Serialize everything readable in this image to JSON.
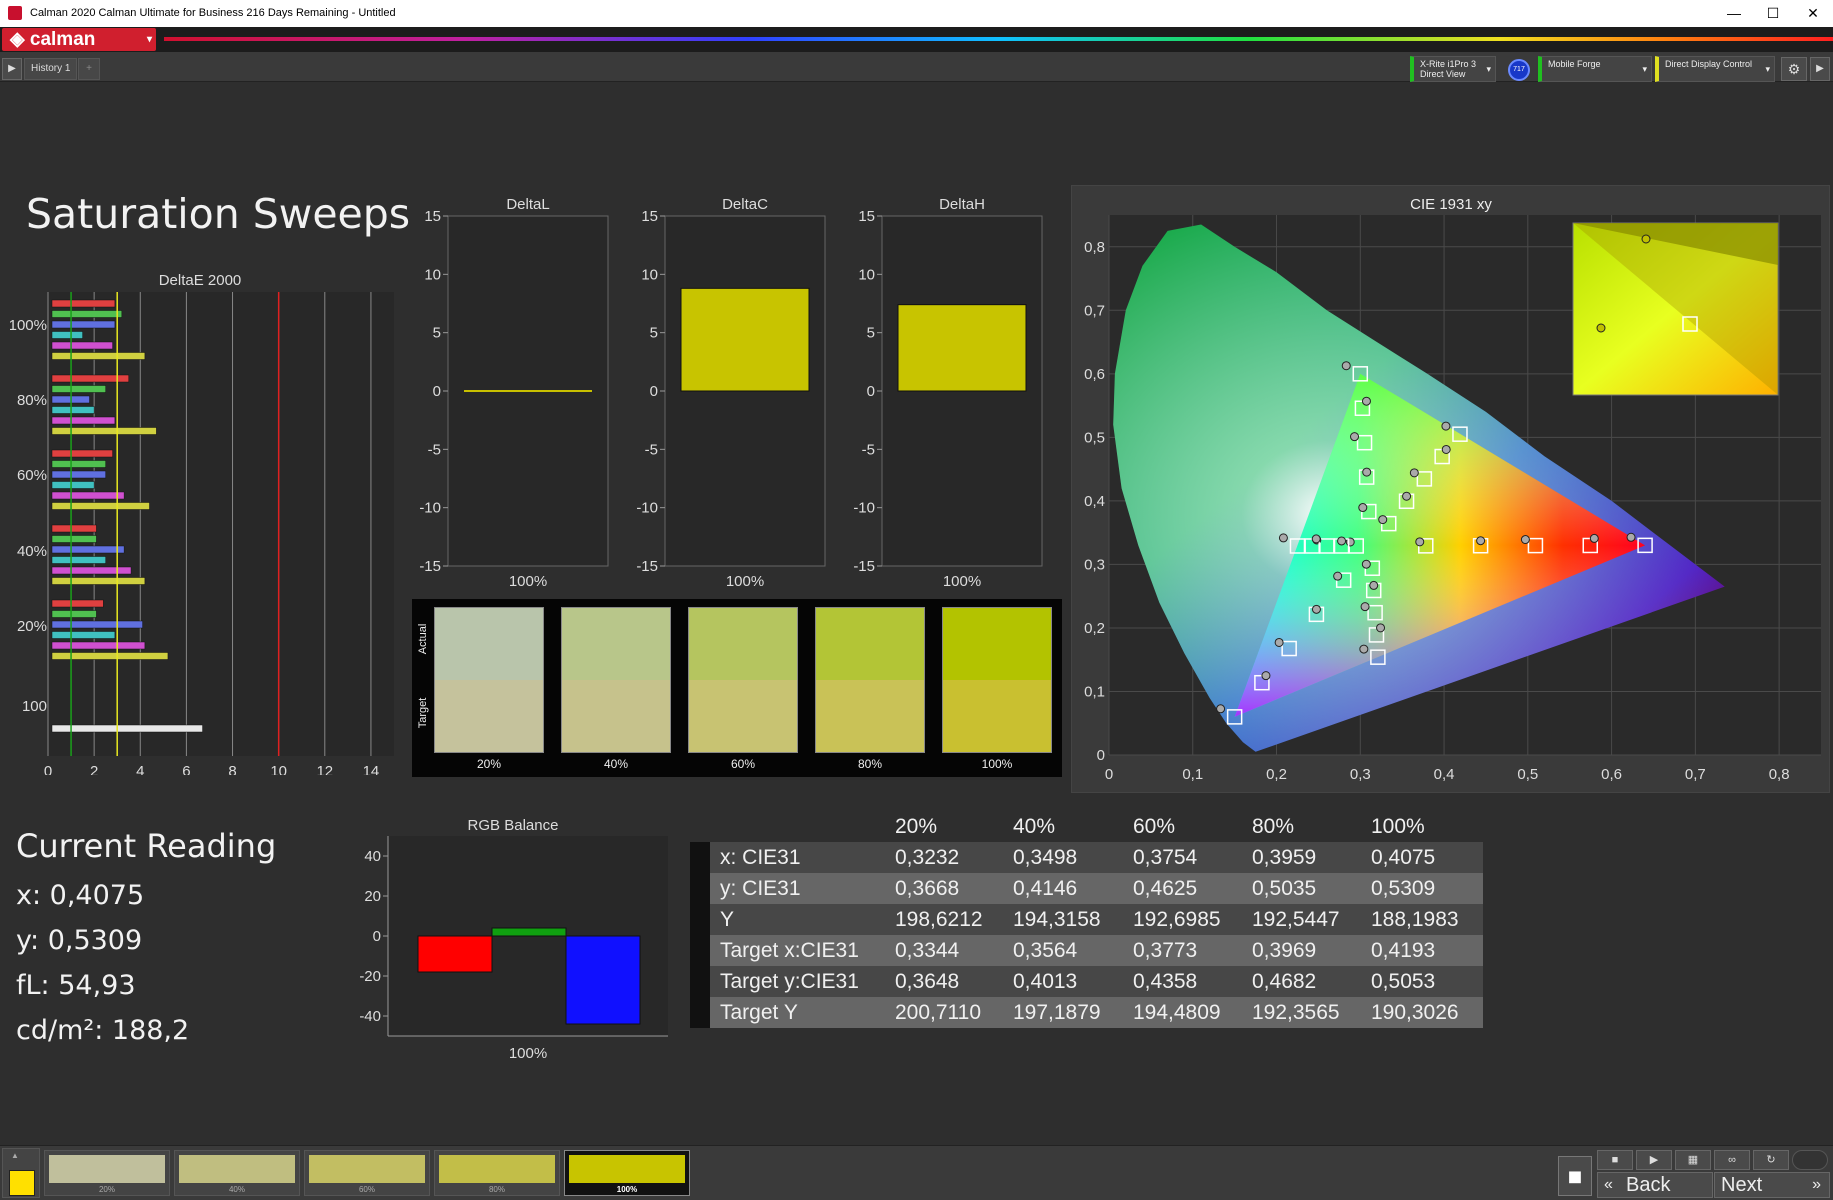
{
  "window": {
    "title": "Calman 2020 Calman Ultimate for Business 216 Days Remaining - Untitled",
    "minimize": "—",
    "maximize": "☐",
    "close": "✕"
  },
  "logo": {
    "text": "calman",
    "arrow": "▾"
  },
  "tabs": [
    {
      "label": "History 1"
    },
    {
      "label": "+"
    }
  ],
  "devices": [
    {
      "line1": "X-Rite i1Pro 3",
      "line2": "Direct View",
      "badge": "717"
    },
    {
      "line1": "Mobile Forge",
      "line2": ""
    },
    {
      "line1": "Direct Display Control",
      "line2": ""
    }
  ],
  "page_title": "Saturation Sweeps",
  "deltae": {
    "title": "DeltaE 2000",
    "row_labels": [
      "100%",
      "80%",
      "60%",
      "40%",
      "20%",
      "100"
    ],
    "x_ticks": [
      "0",
      "2",
      "4",
      "6",
      "8",
      "10",
      "12",
      "14"
    ],
    "xlim": [
      0,
      15
    ],
    "thresholds": [
      {
        "value": 1,
        "color": "#1aa01a"
      },
      {
        "value": 3,
        "color": "#e8e820"
      },
      {
        "value": 10,
        "color": "#e02020"
      }
    ],
    "groups": [
      {
        "label": "100%",
        "values": [
          2.9,
          3.2,
          2.9,
          1.5,
          2.8,
          4.2
        ]
      },
      {
        "label": "80%",
        "values": [
          3.5,
          2.5,
          1.8,
          2.0,
          2.9,
          4.7
        ]
      },
      {
        "label": "60%",
        "values": [
          2.8,
          2.5,
          2.5,
          2.0,
          3.3,
          4.4
        ]
      },
      {
        "label": "40%",
        "values": [
          2.1,
          2.1,
          3.3,
          2.5,
          3.6,
          4.2
        ]
      },
      {
        "label": "20%",
        "values": [
          2.4,
          2.1,
          4.1,
          2.9,
          4.2,
          5.2
        ]
      },
      {
        "label": "100",
        "values": [
          6.7
        ]
      }
    ],
    "series_colors": [
      "#e04040",
      "#50c050",
      "#6070e0",
      "#40c0c0",
      "#d050d0",
      "#d0d040"
    ]
  },
  "delta_charts": [
    {
      "title": "DeltaL",
      "value": 0.0,
      "xlabel": "100%"
    },
    {
      "title": "DeltaC",
      "value": 8.8,
      "xlabel": "100%"
    },
    {
      "title": "DeltaH",
      "value": 7.4,
      "xlabel": "100%"
    }
  ],
  "delta_ticks": [
    "15",
    "10",
    "5",
    "0",
    "-5",
    "-10",
    "-15"
  ],
  "delta_ylim": [
    -15,
    15
  ],
  "swatches": {
    "actual_label": "Actual",
    "target_label": "Target",
    "items": [
      {
        "label": "20%",
        "actual": "#b9c5ab",
        "target": "#c5c29c"
      },
      {
        "label": "40%",
        "actual": "#b8c68a",
        "target": "#c6c28c"
      },
      {
        "label": "60%",
        "actual": "#b5c55f",
        "target": "#c8c372"
      },
      {
        "label": "80%",
        "actual": "#b3c536",
        "target": "#c9c257"
      },
      {
        "label": "100%",
        "actual": "#b3c300",
        "target": "#c9c030"
      }
    ]
  },
  "cie": {
    "title": "CIE 1931 xy",
    "x_ticks": [
      "0",
      "0,1",
      "0,2",
      "0,3",
      "0,4",
      "0,5",
      "0,6",
      "0,7",
      "0,8"
    ],
    "y_ticks": [
      "0",
      "0,1",
      "0,2",
      "0,3",
      "0,4",
      "0,5",
      "0,6",
      "0,7",
      "0,8"
    ],
    "xlim": [
      0,
      0.85
    ],
    "ylim": [
      0,
      0.85
    ]
  },
  "current_reading": {
    "title": "Current Reading",
    "x": "x: 0,4075",
    "y": "y: 0,5309",
    "fl": "fL: 54,93",
    "cdm2": "cd/m²: 188,2"
  },
  "rgb_balance": {
    "title": "RGB Balance",
    "y_ticks": [
      "40",
      "20",
      "0",
      "-20",
      "-40"
    ],
    "ylim": [
      -50,
      50
    ],
    "xlabel": "100%",
    "bars": [
      {
        "name": "R",
        "value": -18,
        "color": "#ff0000"
      },
      {
        "name": "G",
        "value": 4,
        "color": "#10a010"
      },
      {
        "name": "B",
        "value": -44,
        "color": "#1010ff"
      }
    ]
  },
  "table": {
    "headers": [
      "",
      "20%",
      "40%",
      "60%",
      "80%",
      "100%"
    ],
    "rows": [
      {
        "label": "x: CIE31",
        "values": [
          "0,3232",
          "0,3498",
          "0,3754",
          "0,3959",
          "0,4075"
        ]
      },
      {
        "label": "y: CIE31",
        "values": [
          "0,3668",
          "0,4146",
          "0,4625",
          "0,5035",
          "0,5309"
        ]
      },
      {
        "label": "Y",
        "values": [
          "198,6212",
          "194,3158",
          "192,6985",
          "192,5447",
          "188,1983"
        ]
      },
      {
        "label": "Target x:CIE31",
        "values": [
          "0,3344",
          "0,3564",
          "0,3773",
          "0,3969",
          "0,4193"
        ]
      },
      {
        "label": "Target y:CIE31",
        "values": [
          "0,3648",
          "0,4013",
          "0,4358",
          "0,4682",
          "0,5053"
        ]
      },
      {
        "label": "Target Y",
        "values": [
          "200,7110",
          "197,1879",
          "194,4809",
          "192,3565",
          "190,3026"
        ]
      }
    ]
  },
  "bottom": {
    "current_color": "#ffe000",
    "swatches": [
      {
        "label": "20%",
        "color": "#c0bf9c"
      },
      {
        "label": "40%",
        "color": "#c0be80"
      },
      {
        "label": "60%",
        "color": "#c2be62"
      },
      {
        "label": "80%",
        "color": "#c2be48"
      },
      {
        "label": "100%",
        "color": "#c8c400"
      }
    ],
    "back_label": "Back",
    "next_label": "Next"
  }
}
